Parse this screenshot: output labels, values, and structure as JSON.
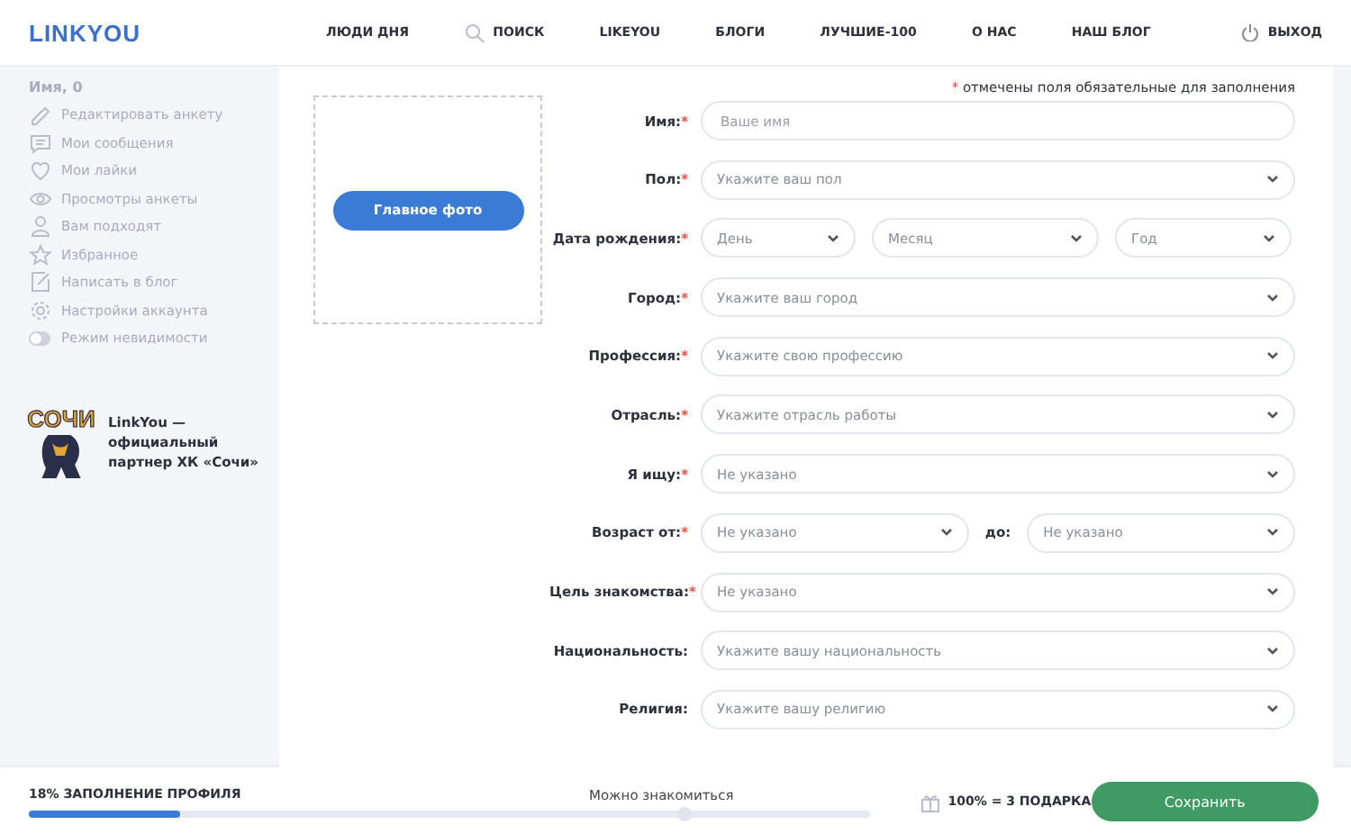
{
  "header": {
    "logo": "LINKYOU",
    "nav": [
      {
        "label": "ЛЮДИ ДНЯ"
      },
      {
        "label": "ПОИСК"
      },
      {
        "label": "LIKEYOU"
      },
      {
        "label": "БЛОГИ"
      },
      {
        "label": "ЛУЧШИЕ-100"
      },
      {
        "label": "О НАС"
      },
      {
        "label": "НАШ БЛОГ"
      }
    ],
    "logout": "ВЫХОД"
  },
  "sidebar": {
    "user": "Имя, 0",
    "items": [
      {
        "label": "Редактировать анкету",
        "kind": "link"
      },
      {
        "label": "Мои сообщения",
        "kind": "link"
      },
      {
        "label": "Мои лайки",
        "kind": "link"
      },
      {
        "label": "Просмотры анкеты",
        "kind": "link"
      },
      {
        "label": "Вам подходят",
        "kind": "link"
      },
      {
        "label": "Избранное",
        "kind": "link"
      },
      {
        "label": "Написать в блог",
        "kind": "link"
      },
      {
        "label": "Настройки аккаунта",
        "kind": "link"
      },
      {
        "label": "Режим невидимости",
        "kind": "toggle",
        "on": false
      }
    ],
    "partner": {
      "logo_text": "СОЧИ",
      "text": "LinkYou — официальный партнер ХК «Сочи»"
    }
  },
  "form": {
    "required_mark": "*",
    "required_note": "отмечены поля обязательные для заполнения",
    "photo_button": "Главное фото",
    "fields": [
      {
        "label": "Имя:",
        "required": true,
        "kind": "text",
        "placeholder": "Ваше имя"
      },
      {
        "label": "Пол:",
        "required": true,
        "kind": "select",
        "placeholder": "Укажите ваш пол"
      },
      {
        "label": "Дата рождения:",
        "required": true,
        "kind": "date",
        "parts": [
          "День",
          "Месяц",
          "Год"
        ]
      },
      {
        "label": "Город:",
        "required": true,
        "kind": "select",
        "placeholder": "Укажите ваш город"
      },
      {
        "label": "Профессия:",
        "required": true,
        "kind": "select",
        "placeholder": "Укажите свою профессию"
      },
      {
        "label": "Отрасль:",
        "required": true,
        "kind": "select",
        "placeholder": "Укажите отрасль работы"
      },
      {
        "label": "Я ищу:",
        "required": true,
        "kind": "select",
        "placeholder": "Не указано"
      },
      {
        "label": "Возраст от:",
        "required": true,
        "kind": "range",
        "placeholder": "Не указано",
        "to_label": "до:",
        "to_placeholder": "Не указано"
      },
      {
        "label": "Цель знакомства:",
        "required": true,
        "kind": "select",
        "placeholder": "Не указано"
      },
      {
        "label": "Национальность:",
        "required": false,
        "kind": "select",
        "placeholder": "Укажите вашу национальность"
      },
      {
        "label": "Религия:",
        "required": false,
        "kind": "select",
        "placeholder": "Укажите вашу религию"
      }
    ]
  },
  "footer": {
    "progress_label": "18% ЗАПОЛНЕНИЕ ПРОФИЛЯ",
    "level": 0.18,
    "milestone": "Можно знакомиться",
    "gift": "100% = 3 ПОДАРКА",
    "save": "Сохранить"
  }
}
